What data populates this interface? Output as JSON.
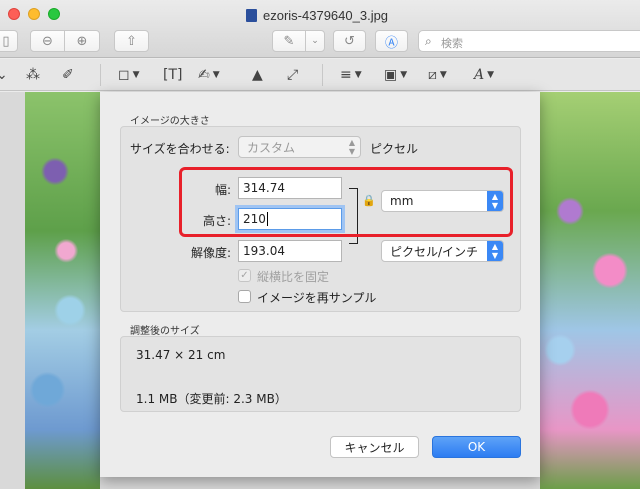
{
  "window": {
    "title": "ezoris-4379640_3.jpg"
  },
  "toolbar": {
    "search_placeholder": "検索"
  },
  "dialog": {
    "image_size_title": "イメージの大きさ",
    "fit_label": "サイズを合わせる:",
    "fit_value": "カスタム",
    "fit_unit": "ピクセル",
    "width_label": "幅:",
    "width_value": "314.74",
    "height_label": "高さ:",
    "height_value": "210",
    "unit_value": "mm",
    "resolution_label": "解像度:",
    "resolution_value": "193.04",
    "resolution_unit": "ピクセル/インチ",
    "scale_proportionally": {
      "label": "縦横比を固定",
      "checked": true,
      "enabled": false
    },
    "resample": {
      "label": "イメージを再サンプル",
      "checked": false,
      "enabled": true
    },
    "result_title": "調整後のサイズ",
    "result_dimensions": "31.47 × 21 cm",
    "result_filesize": "1.1 MB（変更前: 2.3 MB）",
    "cancel_label": "キャンセル",
    "ok_label": "OK"
  },
  "colors": {
    "accent": "#3b88f5",
    "highlight": "#e8202a"
  }
}
